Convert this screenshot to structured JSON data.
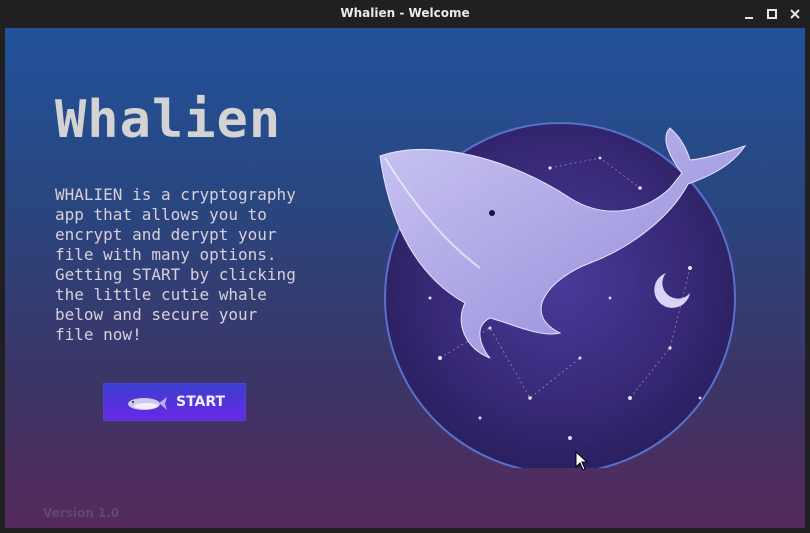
{
  "window": {
    "title": "Whalien - Welcome"
  },
  "app": {
    "title": "Whalien",
    "description": "WHALIEN is a cryptography\napp that allows you to\nencrypt and derypt your\nfile with many options.\nGetting START by clicking\nthe little cutie whale\nbelow and secure your\nfile now!",
    "start_label": "START",
    "version": "Version 1.0"
  },
  "colors": {
    "accent": "#6a28e8",
    "bg_top": "#22529b",
    "bg_bottom": "#552a5c"
  },
  "icons": [
    "minimize-icon",
    "maximize-icon",
    "close-icon",
    "whale-icon",
    "cursor-icon"
  ]
}
